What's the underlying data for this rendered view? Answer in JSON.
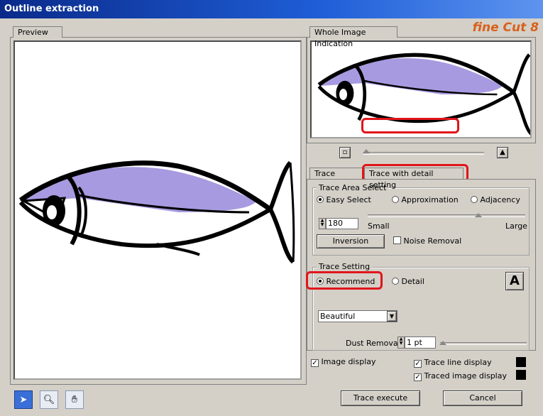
{
  "window": {
    "title": "Outline extraction"
  },
  "logo": {
    "text": "fine Cut 8"
  },
  "preview": {
    "tab_label": "Preview"
  },
  "whole_image": {
    "tab_label": "Whole Image Indication"
  },
  "tabs": [
    {
      "label": "Trace simply"
    },
    {
      "label": "Trace with detail setting"
    }
  ],
  "trace_area": {
    "legend": "Trace Area Select",
    "options": [
      "Easy Select",
      "Approximation",
      "Adjacency"
    ],
    "selected": "Easy Select",
    "value": "180",
    "small_label": "Small",
    "large_label": "Large",
    "slider_value": 0.62,
    "inversion_label": "Inversion",
    "noise_label": "Noise Removal",
    "noise_checked": false
  },
  "trace_setting": {
    "legend": "Trace Setting",
    "options": [
      "Recommend",
      "Detail"
    ],
    "selected": "Recommend",
    "dropdown_value": "Beautiful",
    "dust_label": "Dust Removal",
    "dust_value": "1 pt"
  },
  "display": {
    "image_display": "Image display",
    "image_display_checked": true,
    "trace_line_display": "Trace line display",
    "trace_line_checked": true,
    "traced_image_display": "Traced image display",
    "traced_image_checked": true
  },
  "buttons": {
    "execute": "Trace execute",
    "cancel": "Cancel"
  },
  "colors": {
    "fish_fill": "#a89ae0",
    "highlight": "#e0151b"
  },
  "tools": [
    "arrow-tool",
    "zoom-tool",
    "hand-tool"
  ]
}
